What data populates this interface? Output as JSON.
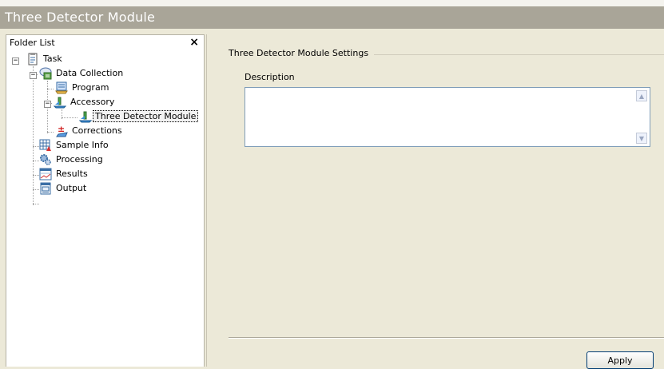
{
  "window": {
    "title": "Three Detector Module"
  },
  "sidebar": {
    "title": "Folder List",
    "close_label": "×",
    "tree": [
      {
        "label": "Task",
        "icon": "task-icon",
        "expanded": true
      },
      {
        "label": "Data Collection",
        "icon": "data-collection-icon",
        "expanded": true
      },
      {
        "label": "Program",
        "icon": "program-icon"
      },
      {
        "label": "Accessory",
        "icon": "accessory-icon",
        "expanded": true
      },
      {
        "label": "Three Detector Module",
        "icon": "accessory-icon",
        "selected": true
      },
      {
        "label": "Corrections",
        "icon": "corrections-icon"
      },
      {
        "label": "Sample Info",
        "icon": "sample-info-icon"
      },
      {
        "label": "Processing",
        "icon": "processing-icon"
      },
      {
        "label": "Results",
        "icon": "results-icon"
      },
      {
        "label": "Output",
        "icon": "output-icon"
      }
    ]
  },
  "main": {
    "group_title": "Three Detector Module Settings",
    "description": {
      "label": "Description",
      "value": ""
    },
    "apply_label": "Apply"
  },
  "colors": {
    "title_bar": "#a9a598",
    "panel": "#ece9d8",
    "field_border": "#7f9db9"
  }
}
